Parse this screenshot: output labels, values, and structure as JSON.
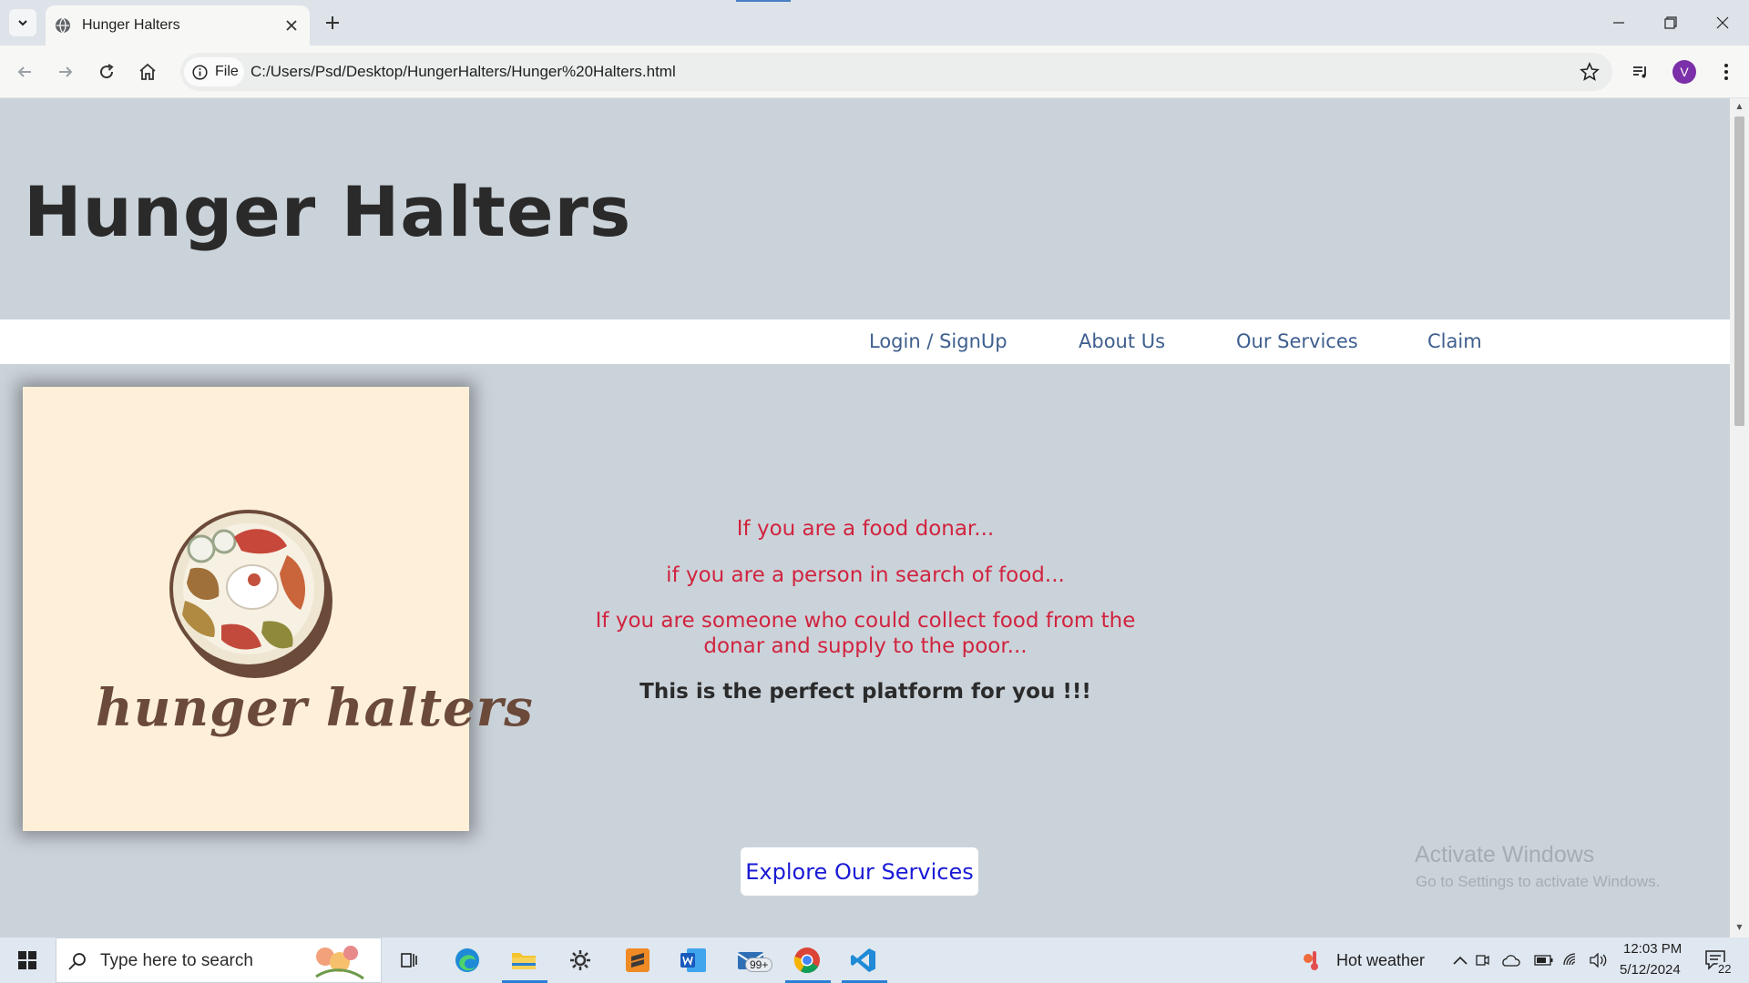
{
  "browser": {
    "tab_title": "Hunger Halters",
    "site_chip_label": "File",
    "url": "C:/Users/Psd/Desktop/HungerHalters/Hunger%20Halters.html",
    "profile_initial": "V"
  },
  "page": {
    "site_title": "Hunger Halters",
    "nav": [
      {
        "label": "Login / SignUp"
      },
      {
        "label": "About Us"
      },
      {
        "label": "Our Services"
      },
      {
        "label": "Claim"
      }
    ],
    "logo_text": "hunger halters",
    "hero": {
      "line1": "If you are a food donar...",
      "line2": "if you are a person in search of food...",
      "line3a": "If you are someone who could collect food from the",
      "line3b": "donar and supply to the poor...",
      "tagline": "This is the perfect platform for you !!!"
    },
    "cta_label": "Explore Our Services"
  },
  "watermark": {
    "title": "Activate Windows",
    "subtitle": "Go to Settings to activate Windows."
  },
  "taskbar": {
    "search_placeholder": "Type here to search",
    "mail_badge": "99+",
    "weather": "Hot weather",
    "time": "12:03 PM",
    "date": "5/12/2024",
    "notifications": "22"
  },
  "colors": {
    "page_bg": "#cbd3da",
    "nav_link": "#3e5f8e",
    "hero_text": "#d0243f",
    "cta_text": "#1a1ad6",
    "logo_bg": "#fef0d8"
  }
}
